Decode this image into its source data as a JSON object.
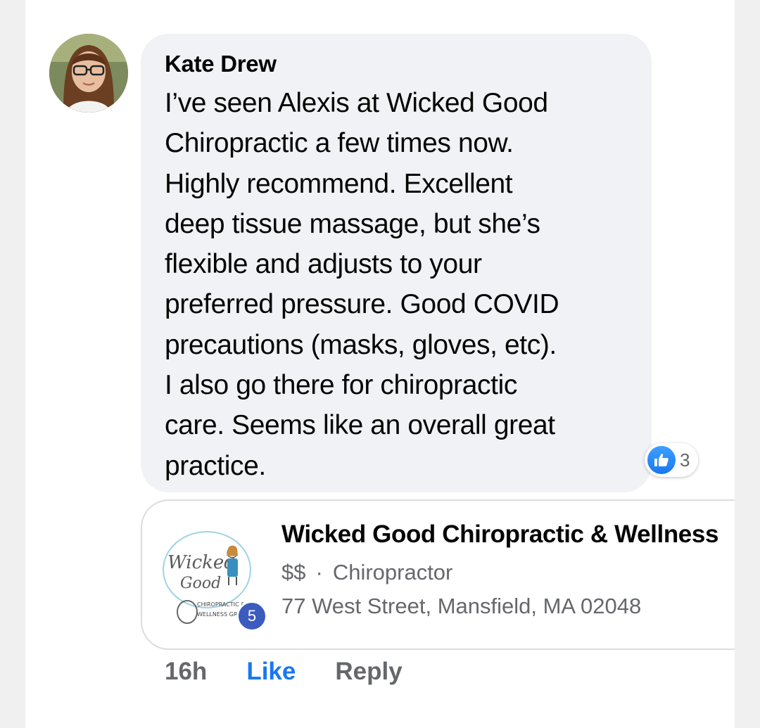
{
  "comment": {
    "author": "Kate Drew",
    "text": "I’ve seen Alexis at Wicked Good\nChiropractic a few times now.\nHighly recommend. Excellent\ndeep tissue massage, but she’s\nflexible and adjusts to your\npreferred pressure. Good COVID\nprecautions (masks, gloves, etc).\nI also go there for chiropractic\ncare. Seems like an overall great\npractice.",
    "avatar_icon": "profile-photo",
    "reactions": {
      "icon": "thumbs-up-icon",
      "count": "3",
      "color": "#1877f2"
    }
  },
  "recommendation_card": {
    "title": "Wicked Good Chiropractic & Wellness",
    "price": "$$",
    "separator": "·",
    "category": "Chiropractor",
    "address": "77 West Street, Mansfield, MA 02048",
    "logo": {
      "line1": "Wicked",
      "line2": "Good",
      "line3": "CHIROPRACTIC &",
      "line4": "WELLNESS GRP"
    },
    "badge_count": "5"
  },
  "actions": {
    "timestamp": "16h",
    "like_label": "Like",
    "reply_label": "Reply"
  },
  "colors": {
    "bubble": "#f0f2f5",
    "primary_text": "#050505",
    "secondary_text": "#65676b",
    "link_blue": "#1877f2",
    "badge": "#3b5bbe"
  }
}
